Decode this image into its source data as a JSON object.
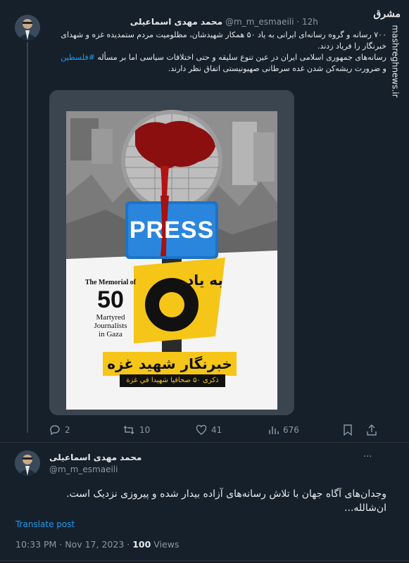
{
  "watermark": {
    "logo_text": "مشرق",
    "site": "mashreghnews.ir"
  },
  "tweet1": {
    "name": "محمد مهدی اسماعیلی",
    "handle": "@m_m_esmaeili",
    "separator": "·",
    "time": "12h",
    "text_line1": "۷۰۰ رسانه و گروه رسانه‌ای ایرانی به یاد ۵۰ همکار شهیدشان، مظلومیت مردم ستمدیده غزه و شهدای",
    "text_line2": "خبرنگار را فریاد زدند.",
    "text_line3_pre": "رسانه‌های جمهوری اسلامی ایران در عین تنوع سلیقه و حتی اختلافات سیاسی اما بر مسأله",
    "hashtag": "#فلسطین",
    "text_line4": "و ضرورت ریشه‌کن شدن غده سرطانی صهیونیستی اتفاق نظر دارند.",
    "poster": {
      "mic_label": "PRESS",
      "en_line1": "The Memorial of",
      "en_number": "50",
      "en_line2": "Martyred",
      "en_line3": "Journalists",
      "en_line4": "in Gaza",
      "fa_top": "به یاد",
      "fa_number": "۵۰",
      "fa_bottom": "خبرنگار شهید غزه",
      "ar_band": "ذکری ۵۰ صحافیا شهیدا في غزة"
    },
    "replies": "2",
    "retweets": "10",
    "likes": "41",
    "views": "676"
  },
  "tweet2": {
    "name": "محمد مهدی اسماعیلی",
    "handle": "@m_m_esmaeili",
    "more": "···",
    "text_line1": "وجدان‌های آگاه جهان با تلاش رسانه‌های آزاده بیدار شده و پیروزی نزدیک است.",
    "text_line2": "ان‌شالله...",
    "translate": "Translate post",
    "timestamp": "10:33 PM · Nov 17, 2023 ·",
    "views_count": "100",
    "views_label": "Views"
  },
  "colors": {
    "background": "#15202b",
    "accent": "#1d9bf0",
    "poster_yellow": "#f5c518",
    "press_blue": "#1e73c8"
  }
}
